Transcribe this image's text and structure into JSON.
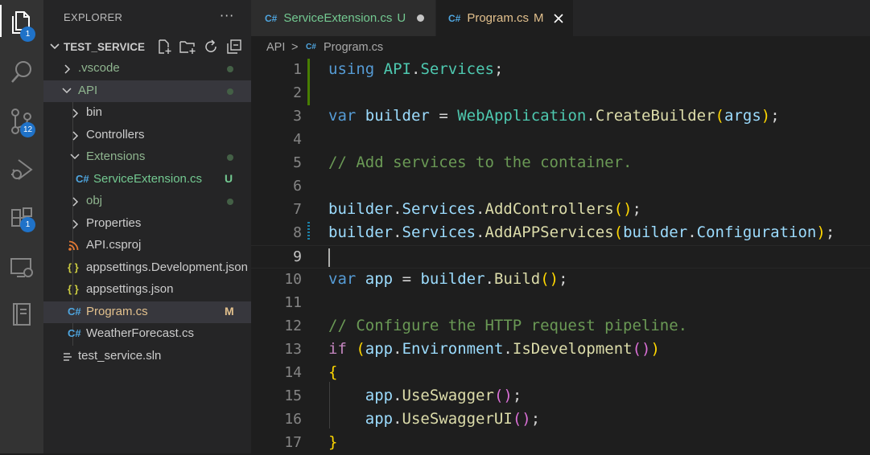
{
  "activity_bar": {
    "explorer_badge": "1",
    "source_control_badge": "12",
    "extensions_badge": "1"
  },
  "sidebar": {
    "title": "EXPLORER",
    "more": "···",
    "section_title": "TEST_SERVICE",
    "tree": [
      {
        "label": ".vscode",
        "status": "",
        "dot": true
      },
      {
        "label": "API",
        "status": "",
        "dot": true
      },
      {
        "label": "bin",
        "status": "",
        "dot": false
      },
      {
        "label": "Controllers",
        "status": "",
        "dot": false
      },
      {
        "label": "Extensions",
        "status": "",
        "dot": true
      },
      {
        "label": "ServiceExtension.cs",
        "status": "U",
        "dot": false
      },
      {
        "label": "obj",
        "status": "",
        "dot": true
      },
      {
        "label": "Properties",
        "status": "",
        "dot": false
      },
      {
        "label": "API.csproj",
        "status": "",
        "dot": false
      },
      {
        "label": "appsettings.Development.json",
        "status": "",
        "dot": false
      },
      {
        "label": "appsettings.json",
        "status": "",
        "dot": false
      },
      {
        "label": "Program.cs",
        "status": "M",
        "dot": false
      },
      {
        "label": "WeatherForecast.cs",
        "status": "",
        "dot": false
      },
      {
        "label": "test_service.sln",
        "status": "",
        "dot": false
      }
    ]
  },
  "tabs": [
    {
      "label": "ServiceExtension.cs",
      "status": "U",
      "active": false
    },
    {
      "label": "Program.cs",
      "status": "M",
      "active": true
    }
  ],
  "breadcrumb": {
    "folder": "API",
    "file": "Program.cs",
    "separator": ">"
  },
  "icons": {
    "csharp": "C#",
    "json": "{ }",
    "chevron_right": "›",
    "chevron_down": "⌄"
  },
  "editor": {
    "line_numbers": [
      "1",
      "2",
      "3",
      "4",
      "5",
      "6",
      "7",
      "8",
      "9",
      "10",
      "11",
      "12",
      "13",
      "14",
      "15",
      "16",
      "17"
    ],
    "active_line": "9",
    "lines": [
      "using API.Services;",
      "",
      "var builder = WebApplication.CreateBuilder(args);",
      "",
      "// Add services to the container.",
      "",
      "builder.Services.AddControllers();",
      "builder.Services.AddAPPServices(builder.Configuration);",
      "",
      "var app = builder.Build();",
      "",
      "// Configure the HTTP request pipeline.",
      "if (app.Environment.IsDevelopment())",
      "{",
      "    app.UseSwagger();",
      "    app.UseSwaggerUI();",
      "}"
    ]
  },
  "colors": {
    "keyword": "#569cd6",
    "type": "#4ec9b0",
    "variable": "#9cdcfe",
    "function": "#dcdcaa",
    "comment": "#6a9955",
    "untracked": "#73c991",
    "modified": "#e2c08d",
    "badge": "#1f72c8"
  }
}
